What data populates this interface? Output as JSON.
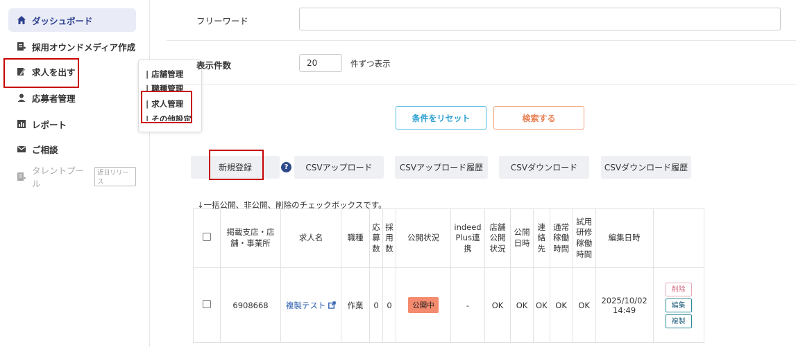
{
  "sidebar": {
    "items": [
      {
        "label": "ダッシュボード",
        "icon": "home-icon"
      },
      {
        "label": "採用オウンドメディア作成",
        "icon": "media-icon"
      },
      {
        "label": "求人を出す",
        "icon": "pen-icon"
      },
      {
        "label": "応募者管理",
        "icon": "person-icon"
      },
      {
        "label": "レポート",
        "icon": "chart-icon"
      },
      {
        "label": "ご相談",
        "icon": "mail-icon"
      },
      {
        "label": "タレントプール",
        "icon": "talent-icon",
        "badge": "近日リリース"
      }
    ]
  },
  "submenu": {
    "items": [
      "| 店舗管理",
      "| 職種管理",
      "| 求人管理",
      "| その他設定"
    ]
  },
  "filters": {
    "freeword_label": "フリーワード",
    "freeword_value": "",
    "count_label": "表示件数",
    "count_value": "20",
    "count_suffix": "件ずつ表示"
  },
  "actions": {
    "reset": "条件をリセット",
    "search": "検索する"
  },
  "toolbar": {
    "new": "新規登録",
    "help": "?",
    "csv_upload": "CSVアップロード",
    "csv_upload_history": "CSVアップロード履歴",
    "csv_download": "CSVダウンロード",
    "csv_download_history": "CSVダウンロード履歴"
  },
  "note": "↓一括公開、非公開、削除のチェックボックスです。",
  "table": {
    "headers": [
      "掲載支店・店舗・事業所",
      "求人名",
      "職種",
      "応募数",
      "採用数",
      "公開状況",
      "indeed Plus連携",
      "店舗公開状況",
      "公開日時",
      "連絡先",
      "通常稼働時間",
      "試用研修稼働時間",
      "編集日時"
    ],
    "rows": [
      {
        "store": "6908668",
        "job_name": "複製テスト",
        "category": "作業",
        "applies": "0",
        "hires": "0",
        "status": "公開中",
        "indeed": "-",
        "store_status": "OK",
        "publish_date": "OK",
        "contact": "OK",
        "normal_hours": "OK",
        "trial_hours": "OK",
        "edit_date": "2025/10/02",
        "edit_time": "14:49",
        "del": "削除",
        "edit": "編集",
        "copy": "複製"
      }
    ]
  },
  "colors": {
    "accent": "#2d3f8f",
    "reset": "#4fb9e3",
    "search": "#e88356",
    "status": "#f48a6e",
    "highlight": "#c80000"
  }
}
